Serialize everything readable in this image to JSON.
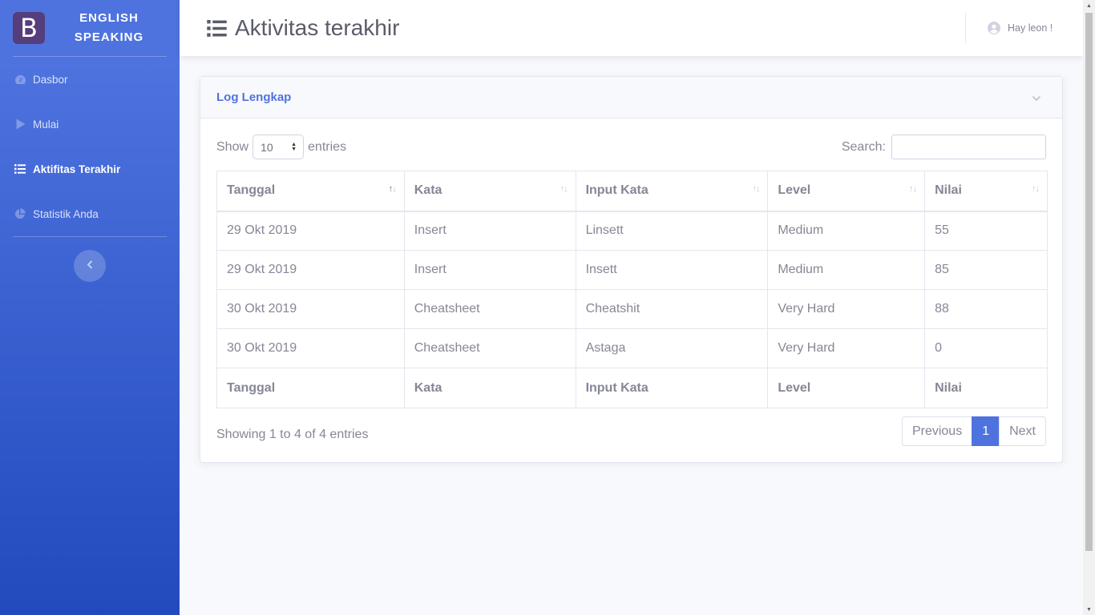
{
  "brand": {
    "logo_letter": "B",
    "line1": "ENGLISH",
    "line2": "SPEAKING"
  },
  "sidebar": {
    "items": [
      {
        "label": "Dasbor",
        "icon": "tachometer-icon",
        "active": false
      },
      {
        "label": "Mulai",
        "icon": "play-icon",
        "active": false
      },
      {
        "label": "Aktifitas Terakhir",
        "icon": "list-icon",
        "active": true
      },
      {
        "label": "Statistik Anda",
        "icon": "pie-chart-icon",
        "active": false
      }
    ],
    "toggle_icon": "chevron-left-icon"
  },
  "topbar": {
    "title": "Aktivitas terakhir",
    "title_icon": "list-icon",
    "user_greeting": "Hay leon !",
    "user_icon": "user-circle-icon"
  },
  "card": {
    "title": "Log Lengkap",
    "collapse_icon": "chevron-down-icon"
  },
  "table_controls": {
    "show_label": "Show",
    "entries_label": "entries",
    "page_size": "10",
    "search_label": "Search:",
    "search_value": ""
  },
  "table": {
    "columns": [
      "Tanggal",
      "Kata",
      "Input Kata",
      "Level",
      "Nilai"
    ],
    "rows": [
      [
        "29 Okt 2019",
        "Insert",
        "Linsett",
        "Medium",
        "55"
      ],
      [
        "29 Okt 2019",
        "Insert",
        "Insett",
        "Medium",
        "85"
      ],
      [
        "30 Okt 2019",
        "Cheatsheet",
        "Cheatshit",
        "Very Hard",
        "88"
      ],
      [
        "30 Okt 2019",
        "Cheatsheet",
        "Astaga",
        "Very Hard",
        "0"
      ]
    ]
  },
  "footer": {
    "info": "Showing 1 to 4 of 4 entries",
    "previous": "Previous",
    "page": "1",
    "next": "Next"
  },
  "colors": {
    "primary": "#4e73df",
    "sidebar_gradient_end": "#224abe",
    "logo_bg": "#563d7c",
    "text_muted": "#858796"
  }
}
